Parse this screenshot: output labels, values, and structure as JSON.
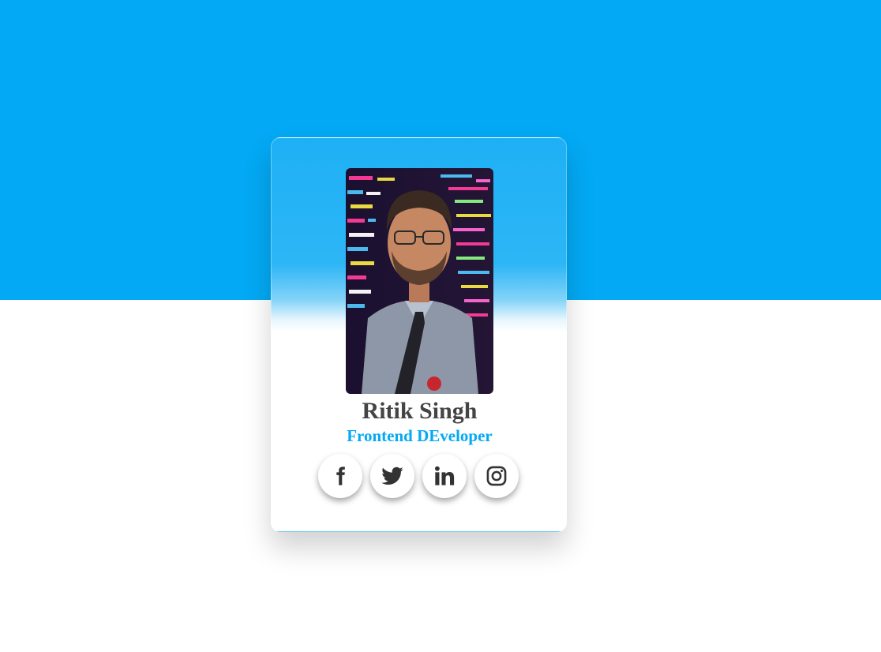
{
  "profile": {
    "name": "Ritik Singh",
    "role": "Frontend DEveloper",
    "photo_alt": "profile photo"
  },
  "socials": [
    {
      "icon": "facebook-icon",
      "label": "Facebook"
    },
    {
      "icon": "twitter-icon",
      "label": "Twitter"
    },
    {
      "icon": "linkedin-icon",
      "label": "LinkedIn"
    },
    {
      "icon": "instagram-icon",
      "label": "Instagram"
    }
  ],
  "colors": {
    "accent": "#03a9f4",
    "name_text": "#444444",
    "icon": "#333333"
  }
}
